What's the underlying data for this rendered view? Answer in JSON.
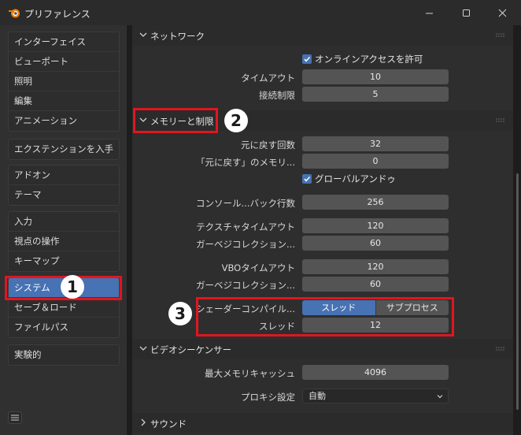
{
  "window": {
    "title": "プリファレンス",
    "minimize": "—",
    "maximize": "☐",
    "close": "✕"
  },
  "sidebar": {
    "groups": [
      [
        "インターフェイス",
        "ビューポート",
        "照明",
        "編集",
        "アニメーション"
      ],
      [
        "エクステンションを入手"
      ],
      [
        "アドオン",
        "テーマ"
      ],
      [
        "入力",
        "視点の操作",
        "キーマップ"
      ],
      [
        "システム",
        "セーブ＆ロード",
        "ファイルパス"
      ],
      [
        "実験的"
      ]
    ],
    "active": "システム"
  },
  "network": {
    "title": "ネットワーク",
    "online_access": "オンラインアクセスを許可",
    "timeout_label": "タイムアウト",
    "timeout": "10",
    "conn_label": "接続制限",
    "conn": "5"
  },
  "memory": {
    "title": "メモリーと制限",
    "undo_steps_label": "元に戻す回数",
    "undo_steps": "32",
    "undo_mem_label": "「元に戻す」のメモリ...",
    "undo_mem": "0",
    "global_undo": "グローバルアンドゥ",
    "console_label": "コンソール...バック行数",
    "console": "256",
    "tex_timeout_label": "テクスチャタイムアウト",
    "tex_timeout": "120",
    "gc1_label": "ガーベジコレクション...",
    "gc1": "60",
    "vbo_timeout_label": "VBOタイムアウト",
    "vbo_timeout": "120",
    "gc2_label": "ガーベジコレクション...",
    "gc2": "60",
    "shader_label": "シェーダーコンパイル...",
    "shader_opt_thread": "スレッド",
    "shader_opt_subprocess": "サブプロセス",
    "threads_label": "スレッド",
    "threads": "12"
  },
  "sequencer": {
    "title": "ビデオシーケンサー",
    "max_cache_label": "最大メモリキャッシュ",
    "max_cache": "4096",
    "proxy_label": "プロキシ設定",
    "proxy": "自動"
  },
  "sound": {
    "title": "サウンド"
  },
  "annotations": {
    "one": "1",
    "two": "2",
    "three": "3"
  },
  "colors": {
    "accent": "#4772b3",
    "annotation": "#e0161f"
  }
}
